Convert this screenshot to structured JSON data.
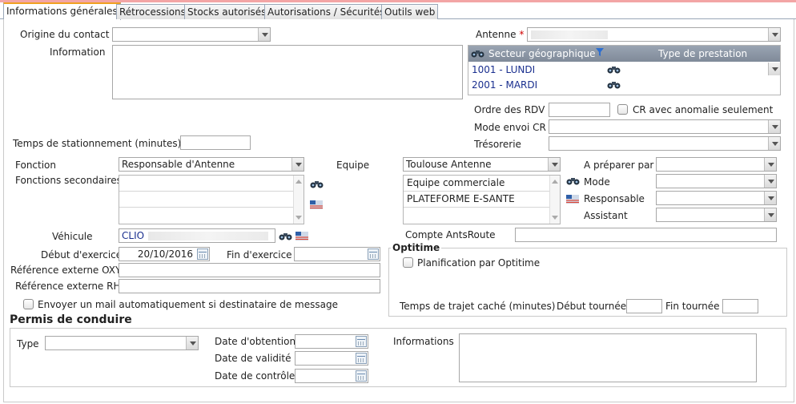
{
  "tabs": [
    {
      "label": "Informations générales"
    },
    {
      "label": "Rétrocessions"
    },
    {
      "label": "Stocks autorisés"
    },
    {
      "label": "Autorisations / Sécurités"
    },
    {
      "label": "Outils web"
    }
  ],
  "form": {
    "origine_label": "Origine du contact",
    "origine_value": "",
    "information_label": "Information",
    "antenne_label": "Antenne",
    "antenne_required": "*",
    "secteur_header": "Secteur géographique",
    "type_prestation_header": "Type de prestation",
    "secteurs": [
      {
        "label": "1001 - LUNDI"
      },
      {
        "label": "2001 - MARDI"
      }
    ],
    "ordre_rdv_label": "Ordre des RDV",
    "ordre_rdv_value": "",
    "cr_anomalie_label": "CR avec anomalie seulement",
    "mode_envoi_label": "Mode envoi CR",
    "tresorerie_label": "Trésorerie",
    "temps_stationnement_label": "Temps de stationnement (minutes)",
    "temps_stationnement_value": "",
    "fonction_label": "Fonction",
    "fonction_value": "Responsable d'Antenne",
    "fonctions_secondaires_label": "Fonctions secondaires",
    "equipe_label": "Equipe",
    "equipe_value": "Toulouse Antenne",
    "equipe_list": [
      "Equipe commerciale",
      "PLATEFORME E-SANTE"
    ],
    "a_preparer_label": "A préparer par",
    "mode_label": "Mode",
    "responsable_label": "Responsable",
    "assistant_label": "Assistant",
    "vehicule_label": "Véhicule",
    "vehicule_value": "CLIO",
    "compte_ants_label": "Compte AntsRoute",
    "debut_exercice_label": "Début d'exercice",
    "debut_exercice_value": "20/10/2016",
    "fin_exercice_label": "Fin d'exercice",
    "ref_oxy_label": "Référence externe OXY",
    "ref_rh_label": "Référence externe RH",
    "envoyer_mail_label": "Envoyer un mail automatiquement si destinataire de message"
  },
  "optitime": {
    "legend": "Optitime",
    "planification_label": "Planification par Optitime",
    "temps_trajet_label": "Temps de trajet caché (minutes)",
    "debut_tournee_label": "Début tournée",
    "fin_tournee_label": "Fin tournée"
  },
  "permis": {
    "title": "Permis de conduire",
    "type_label": "Type",
    "date_obtention_label": "Date d'obtention",
    "date_validite_label": "Date de validité",
    "date_controle_label": "Date de contrôle",
    "informations_label": "Informations"
  },
  "colors": {
    "required": "#d00000",
    "link": "#1a2f8f",
    "tab_accent": "#f0a020"
  }
}
